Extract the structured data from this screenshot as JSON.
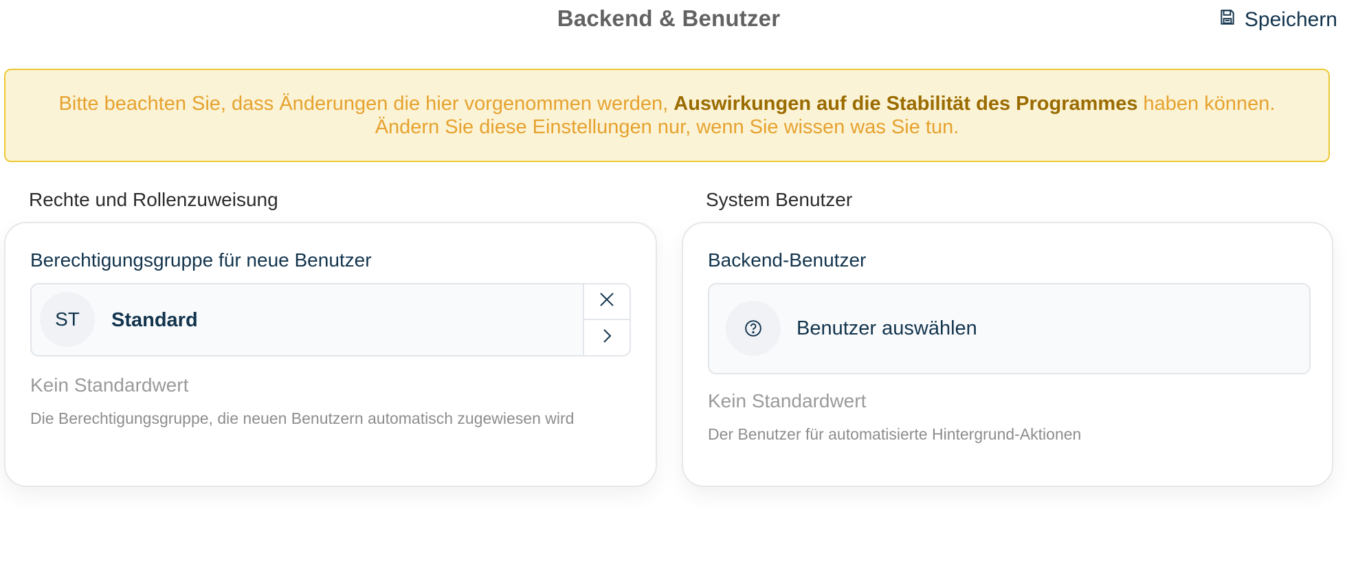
{
  "header": {
    "title": "Backend & Benutzer",
    "save_label": "Speichern"
  },
  "warning": {
    "text_before": "Bitte beachten Sie, dass Änderungen die hier vorgenommen werden, ",
    "text_bold": "Auswirkungen auf die Stabilität des Programmes",
    "text_after": " haben können.",
    "line2": "Ändern Sie diese Einstellungen nur, wenn Sie wissen was Sie tun."
  },
  "left_section": {
    "heading": "Rechte und Rollenzuweisung",
    "field_label": "Berechtigungsgruppe für neue Benutzer",
    "avatar_initials": "ST",
    "selected_value": "Standard",
    "default_value": "Kein Standardwert",
    "hint": "Die Berechtigungsgruppe, die neuen Benutzern automatisch zugewiesen wird"
  },
  "right_section": {
    "heading": "System Benutzer",
    "field_label": "Backend-Benutzer",
    "placeholder": "Benutzer auswählen",
    "default_value": "Kein Standardwert",
    "hint": "Der Benutzer für automatisierte Hintergrund-Aktionen"
  },
  "icons": {
    "save": "floppy-disk-icon",
    "clear": "close-icon",
    "open": "chevron-right-icon",
    "unknown_user": "question-circle-icon"
  },
  "colors": {
    "warning_bg": "#fbf3d6",
    "warning_border": "#ecc832",
    "warning_text": "#e6a22e",
    "warning_bold": "#9a6b00",
    "accent_text": "#12344d"
  }
}
